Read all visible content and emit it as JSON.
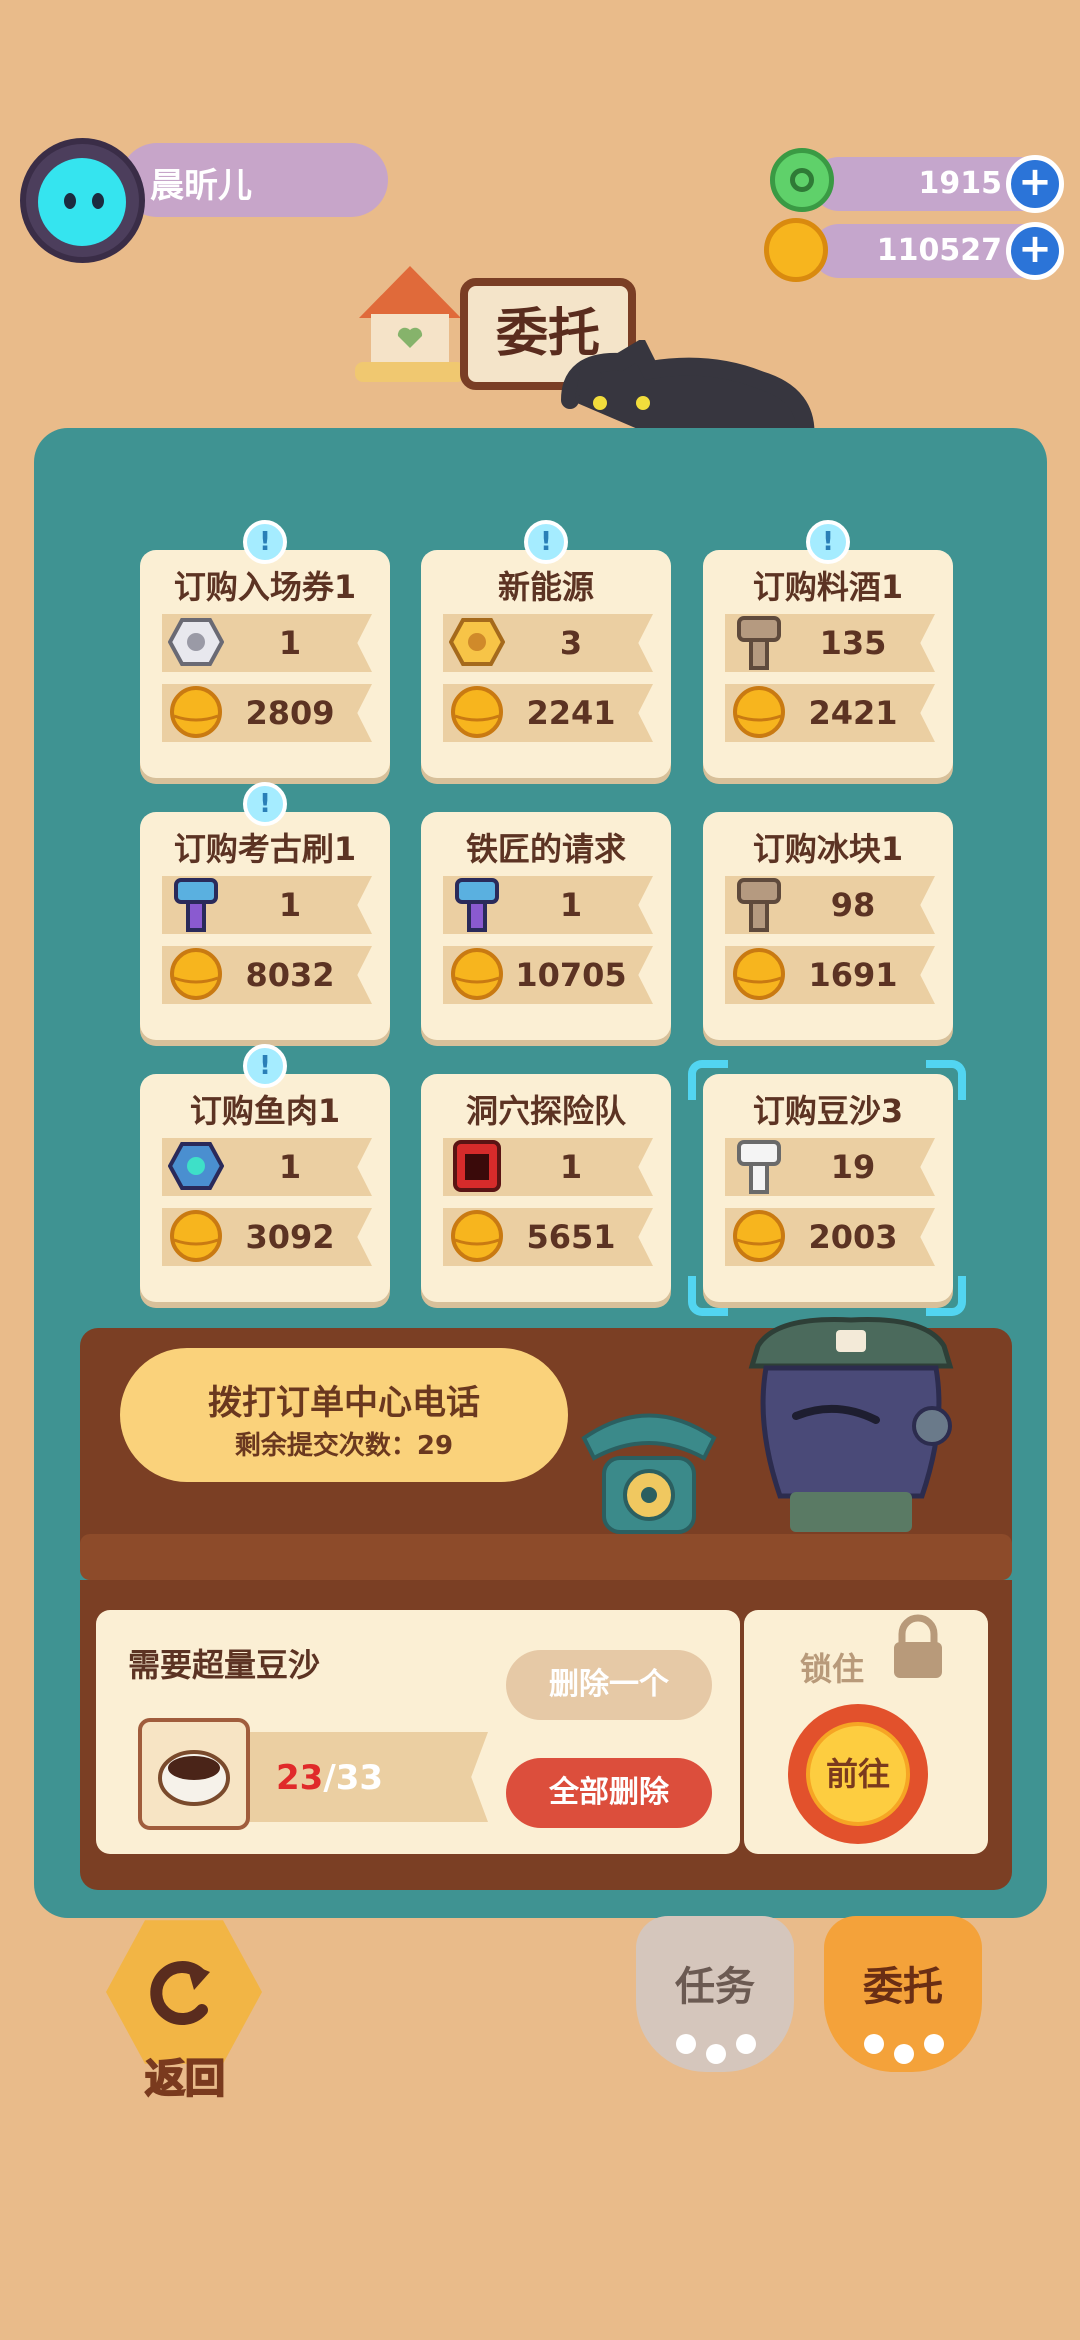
{
  "profile": {
    "name": "晨昕儿"
  },
  "currencies": [
    {
      "name": "gem",
      "value": "1915",
      "color": "#5fd16a"
    },
    {
      "name": "gold",
      "value": "110527",
      "color": "#f7b51e"
    }
  ],
  "title": "委托",
  "orders": [
    {
      "title": "订购入场券1",
      "alert": true,
      "item_icon": "silver-nut-icon",
      "qty": "1",
      "reward": "2809"
    },
    {
      "title": "新能源",
      "alert": true,
      "item_icon": "gold-nut-icon",
      "qty": "3",
      "reward": "2241"
    },
    {
      "title": "订购料酒1",
      "alert": true,
      "item_icon": "bronze-bolt-icon",
      "qty": "135",
      "reward": "2421"
    },
    {
      "title": "订购考古刷1",
      "alert": true,
      "item_icon": "rainbow-bolt-icon",
      "qty": "1",
      "reward": "8032"
    },
    {
      "title": "铁匠的请求",
      "alert": false,
      "item_icon": "rainbow-bolt-icon",
      "qty": "1",
      "reward": "10705"
    },
    {
      "title": "订购冰块1",
      "alert": false,
      "item_icon": "bronze-bolt-icon",
      "qty": "98",
      "reward": "1691"
    },
    {
      "title": "订购鱼肉1",
      "alert": true,
      "item_icon": "rainbow-nut-icon",
      "qty": "1",
      "reward": "3092"
    },
    {
      "title": "洞穴探险队",
      "alert": false,
      "item_icon": "battery-icon",
      "qty": "1",
      "reward": "5651"
    },
    {
      "title": "订购豆沙3",
      "alert": false,
      "item_icon": "white-bolt-icon",
      "qty": "19",
      "reward": "2003",
      "selected": true
    }
  ],
  "call": {
    "title": "拨打订单中心电话",
    "remaining_label": "剩余提交次数：29"
  },
  "order_detail": {
    "title": "需要超量豆沙",
    "delete_one": "删除一个",
    "delete_all": "全部删除",
    "progress_current": "23",
    "progress_total": "/33",
    "lock_label": "锁住",
    "goto": "前往"
  },
  "nav": {
    "back": "返回",
    "tasks": "任务",
    "commission": "委托"
  },
  "colors": {
    "panel": "#3f9392",
    "card": "#fbefd4",
    "accent_red": "#dc4e3c",
    "progress_red": "#e02a2a",
    "selection": "#52d5f1"
  }
}
